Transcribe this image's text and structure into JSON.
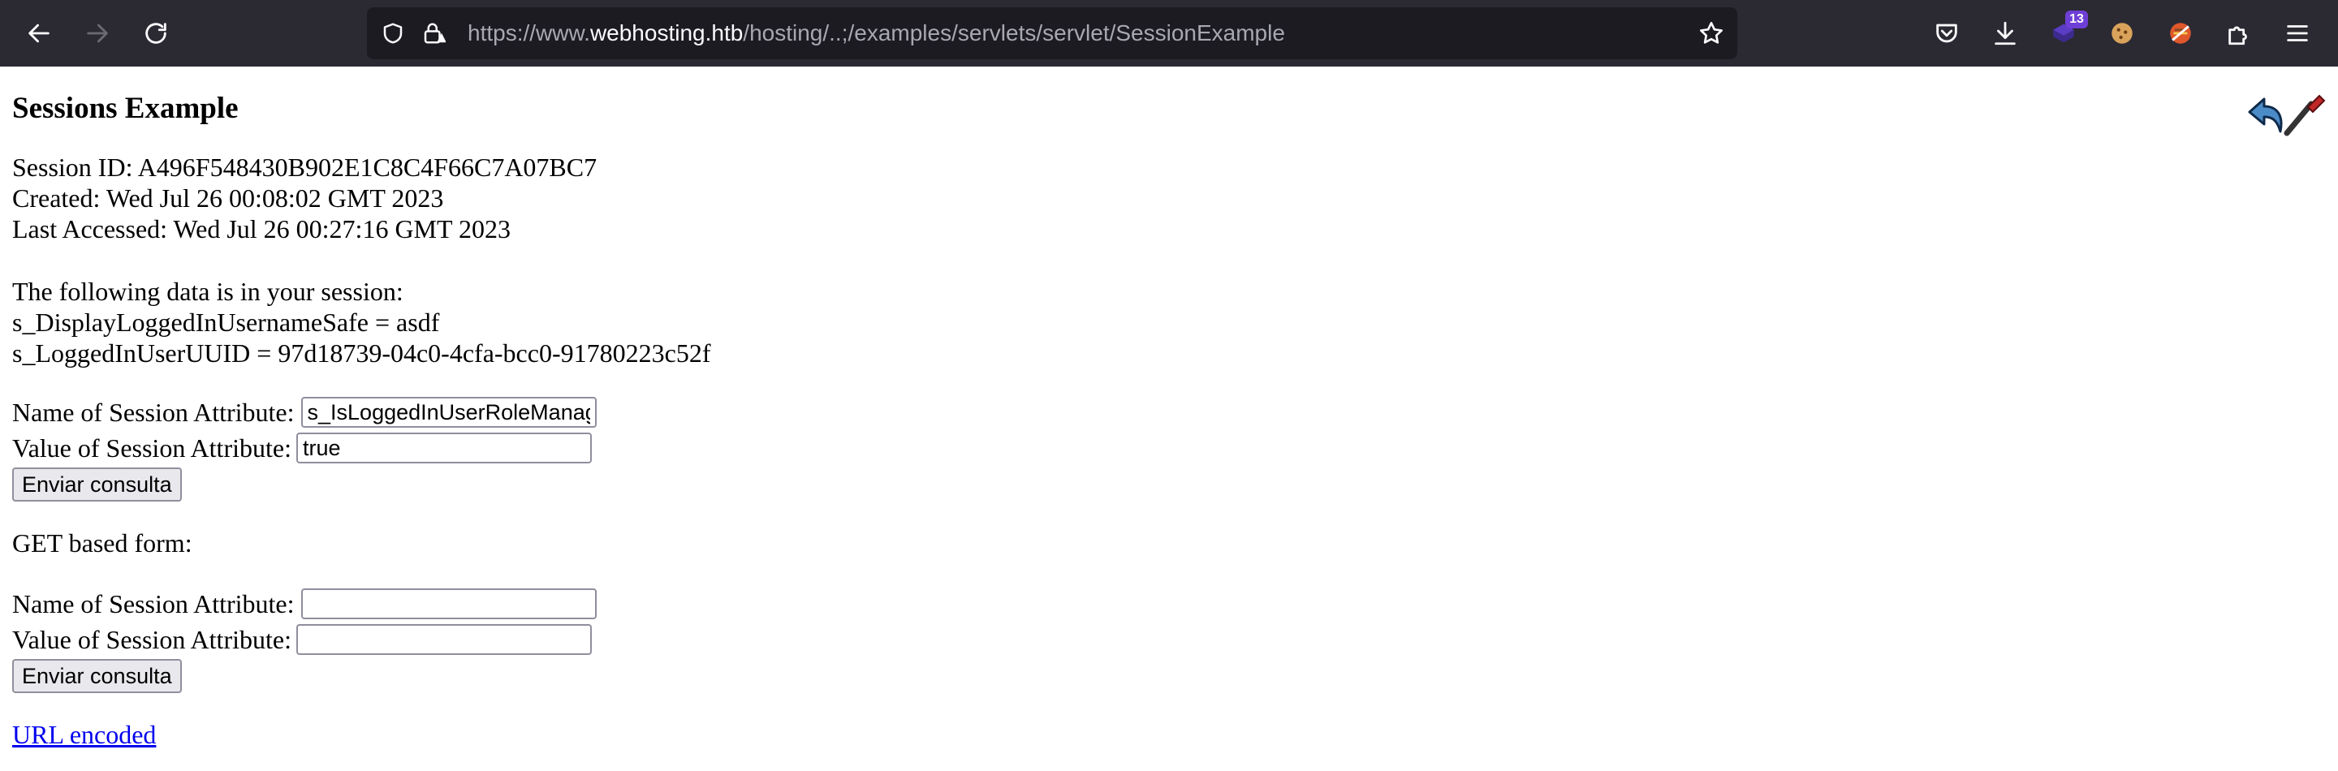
{
  "browser": {
    "url_prefix": "https://www.",
    "url_host": "webhosting.htb",
    "url_path": "/hosting/..;/examples/servlets/servlet/SessionExample",
    "extension_badge_count": "13",
    "icons": [
      "back-icon",
      "forward-icon",
      "reload-icon",
      "shield-icon",
      "lock-warning-icon",
      "bookmark-star-icon",
      "pocket-icon",
      "download-icon",
      "extension-icon",
      "cookie-icon",
      "burger-extension-icon",
      "puzzle-icon",
      "menu-icon"
    ]
  },
  "page": {
    "title": "Sessions Example",
    "session_id": "Session ID: A496F548430B902E1C8C4F66C7A07BC7",
    "created": "Created: Wed Jul 26 00:08:02 GMT 2023",
    "last_accessed": "Last Accessed: Wed Jul 26 00:27:16 GMT 2023",
    "data_intro": "The following data is in your session:",
    "attributes": [
      "s_DisplayLoggedInUsernameSafe = asdf",
      "s_LoggedInUserUUID = 97d18739-04c0-4cfa-bcc0-91780223c52f"
    ],
    "post_form": {
      "name_label": "Name of Session Attribute:",
      "name_value": "s_IsLoggedInUserRoleManag",
      "value_label": "Value of Session Attribute:",
      "value_value": "true",
      "submit_label": "Enviar consulta"
    },
    "get_form_heading": "GET based form:",
    "get_form": {
      "name_label": "Name of Session Attribute:",
      "name_value": "",
      "value_label": "Value of Session Attribute:",
      "value_value": "",
      "submit_label": "Enviar consulta"
    },
    "url_encoded_link": "URL encoded"
  }
}
